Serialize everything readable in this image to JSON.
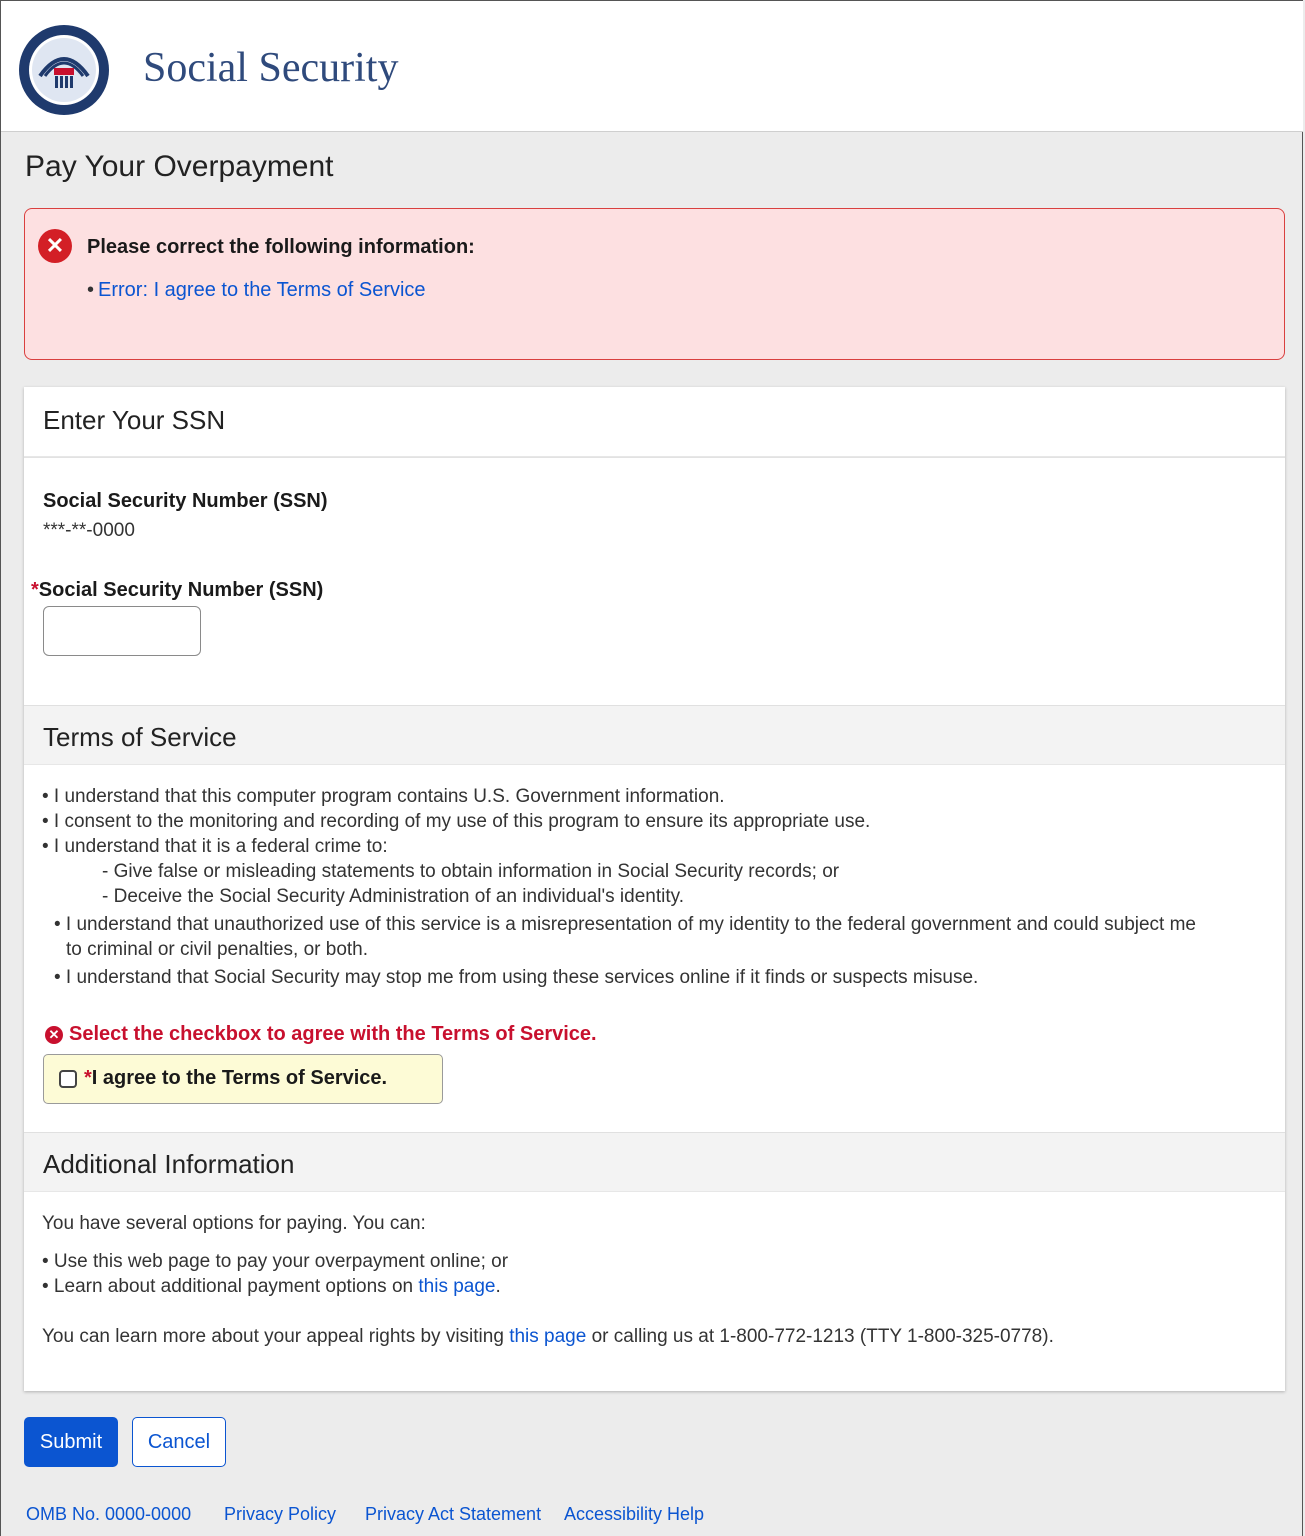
{
  "header": {
    "brand": "Social Security",
    "logo_icon": "ssa-seal-icon"
  },
  "page": {
    "title": "Pay Your Overpayment"
  },
  "alert": {
    "title": "Please correct the following information:",
    "items": [
      {
        "bullet": "•",
        "text": "Error: I agree to the Terms of Service"
      }
    ]
  },
  "ssn_section": {
    "heading": "Enter Your SSN",
    "display_label": "Social Security Number (SSN)",
    "display_value": "***-**-0000",
    "input_required_mark": "*",
    "input_label": "Social Security Number (SSN)",
    "input_value": ""
  },
  "terms_section": {
    "heading": "Terms of Service",
    "lines": [
      "• I understand that this computer program contains U.S. Government information.",
      "• I consent to the monitoring and recording of my use of this program to ensure its appropriate use.",
      "• I understand that it is a federal crime to:",
      "- Give false or misleading statements to obtain information in Social Security records; or",
      "- Deceive the Social Security Administration of an individual's identity.",
      "• I understand that unauthorized use of this service is a misrepresentation of my identity to the federal government and could subject me",
      "to criminal or civil penalties, or both.",
      "• I understand that Social Security may stop me from using these services online if it finds or suspects misuse."
    ],
    "error": "Select the checkbox to agree with the Terms of Service.",
    "agree_required_mark": "*",
    "agree_label": "I agree to the Terms of Service.",
    "agree_checked": false
  },
  "additional_section": {
    "heading": "Additional Information",
    "intro": "You have several options for paying.  You can:",
    "bullet1": "• Use this web page to pay your overpayment online; or",
    "bullet2_prefix": "• Learn about additional payment options on ",
    "bullet2_link": "this page",
    "bullet2_suffix": ".",
    "appeal_prefix": "You can learn more about your appeal rights by visiting ",
    "appeal_link": "this page",
    "appeal_suffix": " or calling us at 1-800-772-1213 (TTY 1-800-325-0778)."
  },
  "actions": {
    "submit": "Submit",
    "cancel": "Cancel"
  },
  "footer": {
    "omb": "OMB No. 0000-0000",
    "privacy_policy": "Privacy Policy",
    "privacy_act": "Privacy Act Statement",
    "accessibility": "Accessibility Help"
  },
  "colors": {
    "brand_blue": "#2f4a7c",
    "link": "#0b55d1",
    "error_red": "#c8102e",
    "alert_bg": "#fde0e1"
  }
}
